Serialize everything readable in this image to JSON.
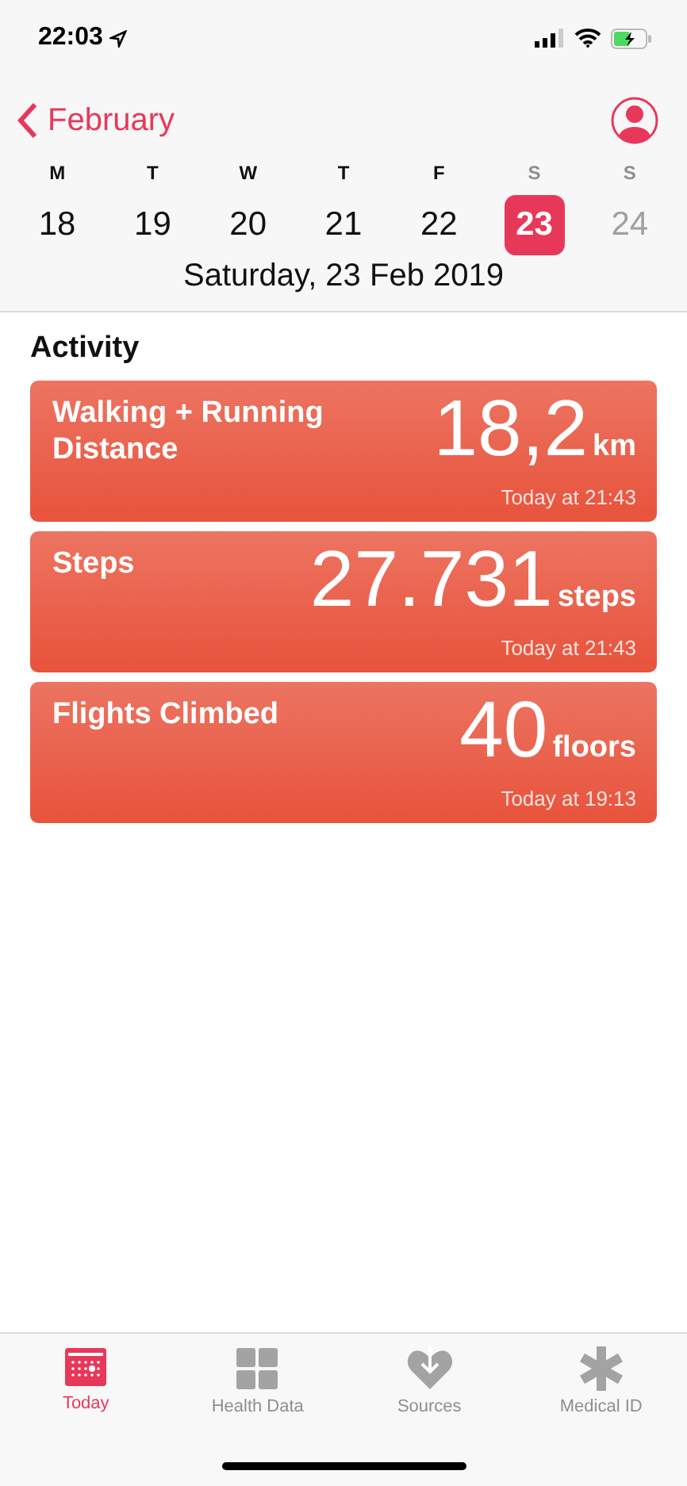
{
  "status_bar": {
    "time": "22:03"
  },
  "nav": {
    "back_label": "February"
  },
  "week": [
    {
      "letter": "M",
      "number": "18",
      "weekend": false,
      "selected": false,
      "future": false
    },
    {
      "letter": "T",
      "number": "19",
      "weekend": false,
      "selected": false,
      "future": false
    },
    {
      "letter": "W",
      "number": "20",
      "weekend": false,
      "selected": false,
      "future": false
    },
    {
      "letter": "T",
      "number": "21",
      "weekend": false,
      "selected": false,
      "future": false
    },
    {
      "letter": "F",
      "number": "22",
      "weekend": false,
      "selected": false,
      "future": false
    },
    {
      "letter": "S",
      "number": "23",
      "weekend": true,
      "selected": true,
      "future": false
    },
    {
      "letter": "S",
      "number": "24",
      "weekend": true,
      "selected": false,
      "future": true
    }
  ],
  "date_title": "Saturday, 23 Feb 2019",
  "section_title": "Activity",
  "cards": [
    {
      "title": "Walking + Running Distance",
      "value": "18,2",
      "unit": "km",
      "time": "Today at 21:43"
    },
    {
      "title": "Steps",
      "value": "27.731",
      "unit": "steps",
      "time": "Today at 21:43"
    },
    {
      "title": "Flights Climbed",
      "value": "40",
      "unit": "floors",
      "time": "Today at 19:13"
    }
  ],
  "tabs": [
    {
      "kind": "calendar",
      "label": "Today",
      "selected": true
    },
    {
      "kind": "grid",
      "label": "Health Data",
      "selected": false
    },
    {
      "kind": "heart",
      "label": "Sources",
      "selected": false
    },
    {
      "kind": "asterisk",
      "label": "Medical ID",
      "selected": false
    }
  ]
}
